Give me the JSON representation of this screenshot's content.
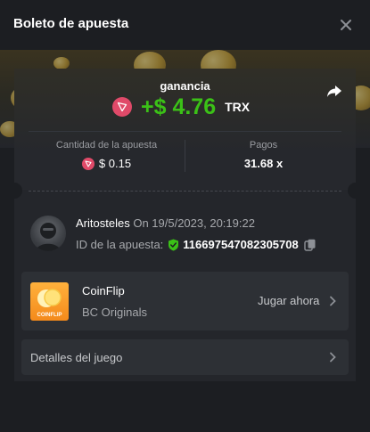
{
  "header": {
    "title": "Boleto de apuesta"
  },
  "win": {
    "label": "ganancia",
    "amount": "+$ 4.76",
    "currency": "TRX"
  },
  "stats": {
    "bet_amount_label": "Cantidad de la apuesta",
    "bet_amount_value": "$ 0.15",
    "payout_label": "Pagos",
    "payout_value": "31.68 x"
  },
  "user": {
    "name": "Aritosteles",
    "date": "On 19/5/2023, 20:19:22",
    "bet_id_label": "ID de la apuesta:",
    "bet_id": "116697547082305708"
  },
  "game": {
    "name": "CoinFlip",
    "provider": "BC Originals",
    "play_label": "Jugar ahora",
    "thumb_label": "COINFLIP"
  },
  "details": {
    "label": "Detalles del juego"
  },
  "colors": {
    "win_green": "#3bc117",
    "trx_red": "#e04a69",
    "background": "#1c1e22",
    "card": "#2d3035"
  },
  "icons": [
    "close-icon",
    "share-icon",
    "trx-icon",
    "shield-check-icon",
    "copy-icon",
    "chevron-right-icon"
  ]
}
